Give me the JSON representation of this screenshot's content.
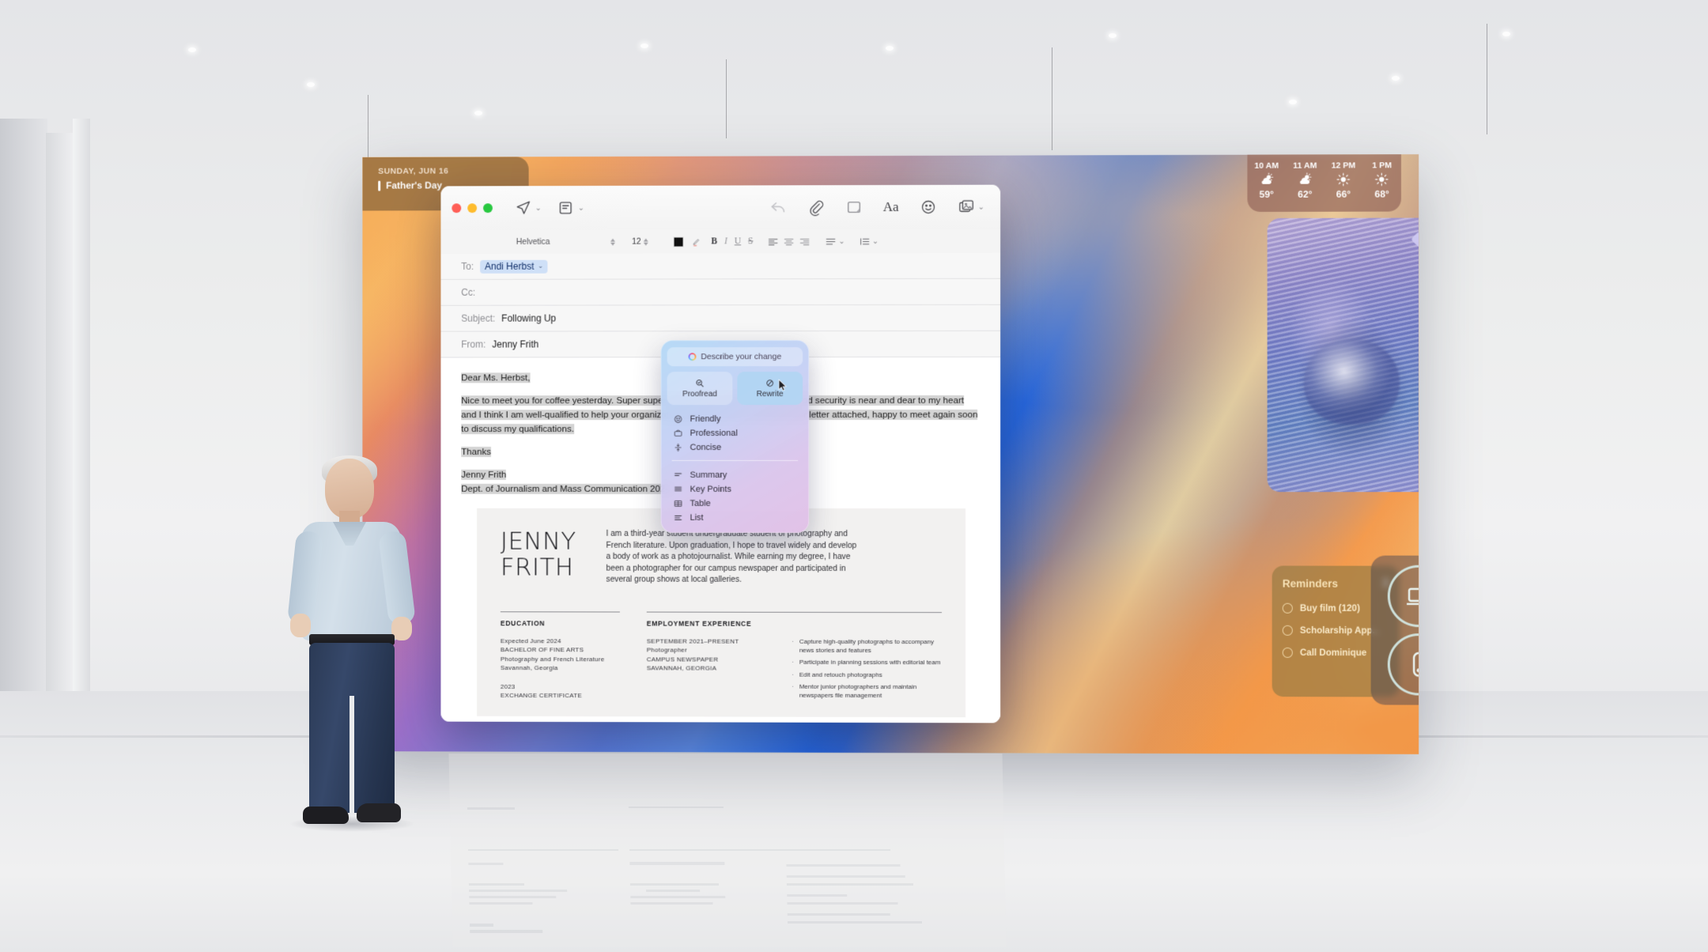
{
  "venue": {
    "name": "apple-park-stage"
  },
  "desktop": {
    "date_widget": {
      "date": "SUNDAY, JUN 16",
      "event": "Father's Day"
    },
    "weather_widget": {
      "hours": [
        {
          "time": "10 AM",
          "icon": "sun-behind-cloud-icon",
          "temp": "59°"
        },
        {
          "time": "11 AM",
          "icon": "sun-behind-cloud-icon",
          "temp": "62°"
        },
        {
          "time": "12 PM",
          "icon": "sun-icon",
          "temp": "66°"
        },
        {
          "time": "1 PM",
          "icon": "sun-icon",
          "temp": "68°"
        }
      ]
    },
    "reminders_widget": {
      "title": "Reminders",
      "count": "3",
      "items": [
        {
          "label": "Buy film (120)"
        },
        {
          "label": "Scholarship App..."
        },
        {
          "label": "Call Dominique"
        }
      ]
    },
    "apps_widget": {
      "items": [
        {
          "icon": "laptop-icon"
        },
        {
          "icon": "mouse-icon"
        }
      ]
    }
  },
  "mail": {
    "toolbar": {
      "send_icon": "send-paper-plane-icon",
      "send_chevron": "⌄",
      "stationery_icon": "stationery-pad-icon",
      "stationery_chevron": "⌄",
      "reply_icon": "reply-arrow-icon",
      "attach_icon": "paperclip-icon",
      "markup_icon": "markup-icon",
      "format_icon": "Aa",
      "emoji_icon": "emoji-smiley-icon",
      "photos_icon": "photo-browser-icon",
      "photos_chevron": "⌄",
      "window_controls": [
        "close",
        "minimize",
        "zoom"
      ]
    },
    "format_bar": {
      "font": "Helvetica",
      "size": "12",
      "color_swatch": "#000000",
      "highlight_icon": "highlight-pen-icon",
      "bold": "B",
      "italic": "I",
      "underline": "U",
      "strikethrough": "S",
      "align_icons": [
        "align-left-icon",
        "align-center-icon",
        "align-right-icon"
      ],
      "list_icon": "list-icon",
      "list_chevron": "⌄",
      "spacing_icon": "line-spacing-icon",
      "spacing_chevron": "⌄"
    },
    "headers": {
      "to_label": "To:",
      "to_value": "Andi Herbst",
      "to_chevron": "⌄",
      "cc_label": "Cc:",
      "cc_value": "",
      "subject_label": "Subject:",
      "subject_value": "Following Up",
      "from_label": "From:",
      "from_value": "Jenny Frith"
    },
    "body": {
      "greeting": "Dear Ms. Herbst,",
      "paragraph": "Nice to meet you for coffee yesterday. Super super excited about this opportunity. Food security is near and dear to my heart and I think I am well-qualified to help your organization grow and thrive. CV and cover letter attached, happy to meet again soon to discuss my qualifications.",
      "closing": "Thanks",
      "signature_name": "Jenny Frith",
      "signature_dept": "Dept. of Journalism and Mass Communication 2024"
    },
    "attachment": {
      "name_line1": "JENNY",
      "name_line2": "FRITH",
      "intro": "I am a third-year student undergraduate student of photography and French literature. Upon graduation, I hope to travel widely and develop a body of work as a photojournalist. While earning my degree, I have been a photographer for our campus newspaper and participated in several group shows at local galleries.",
      "education": {
        "heading": "EDUCATION",
        "entries": [
          {
            "date": "Expected June 2024",
            "degree": "BACHELOR OF FINE ARTS",
            "field": "Photography and French Literature",
            "place": "Savannah, Georgia"
          },
          {
            "date": "2023",
            "degree": "EXCHANGE CERTIFICATE",
            "field": "",
            "place": ""
          }
        ]
      },
      "employment": {
        "heading": "EMPLOYMENT EXPERIENCE",
        "entries": [
          {
            "date": "SEPTEMBER 2021–PRESENT",
            "role": "Photographer",
            "org": "CAMPUS NEWSPAPER",
            "place": "SAVANNAH, GEORGIA"
          }
        ],
        "bullets": [
          "Capture high-quality photographs to accompany news stories and features",
          "Participate in planning sessions with editorial team",
          "Edit and retouch photographs",
          "Mentor junior photographers and maintain newspapers file management"
        ]
      }
    }
  },
  "writing_tools": {
    "describe_placeholder": "Describe your change",
    "describe_icon": "apple-intelligence-icon",
    "buttons": [
      {
        "label": "Proofread",
        "icon": "magnifier-check-icon",
        "active": false
      },
      {
        "label": "Rewrite",
        "icon": "rewrite-circle-icon",
        "active": true
      }
    ],
    "tone_items": [
      {
        "label": "Friendly",
        "icon": "smiley-face-icon"
      },
      {
        "label": "Professional",
        "icon": "briefcase-icon"
      },
      {
        "label": "Concise",
        "icon": "compress-arrows-icon"
      }
    ],
    "format_items": [
      {
        "label": "Summary",
        "icon": "summary-lines-icon"
      },
      {
        "label": "Key Points",
        "icon": "key-points-icon"
      },
      {
        "label": "Table",
        "icon": "table-grid-icon"
      },
      {
        "label": "List",
        "icon": "list-lines-icon"
      }
    ]
  },
  "colors": {
    "accent_blue": "#1557d8",
    "accent_orange": "#f2a24a",
    "selection_blue": "#cfe0f7",
    "traffic_red": "#ff5f57",
    "traffic_yellow": "#febc2e",
    "traffic_green": "#28c840"
  }
}
